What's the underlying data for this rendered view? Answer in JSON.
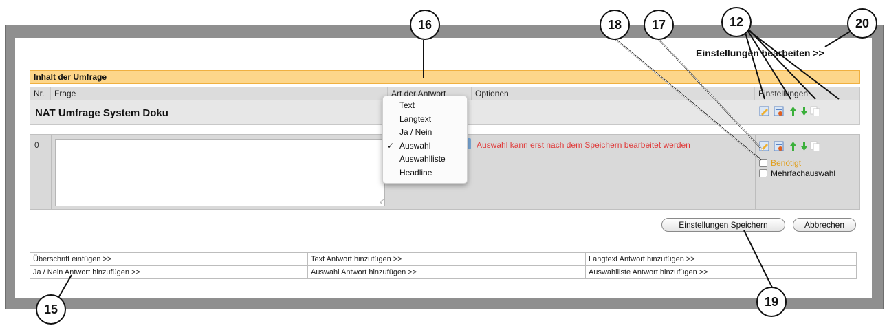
{
  "header": {
    "settings_link": "Einstellungen bearbeiten >>"
  },
  "section": {
    "title": "Inhalt der Umfrage"
  },
  "columns": {
    "nr": "Nr.",
    "frage": "Frage",
    "art": "Art der Antwort",
    "optionen": "Optionen",
    "einstellungen": "Einstellungen"
  },
  "survey": {
    "title": "NAT Umfrage System Doku"
  },
  "question": {
    "number": "0",
    "text_value": "",
    "options_note": "Auswahl kann erst nach dem Speichern bearbeitet werden",
    "required_label": "Benötigt",
    "multi_label": "Mehrfachauswahl"
  },
  "answer_type_menu": {
    "items": [
      "Text",
      "Langtext",
      "Ja / Nein",
      "Auswahl",
      "Auswahlliste",
      "Headline"
    ],
    "selected": "Auswahl",
    "check_mark": "✓"
  },
  "buttons": {
    "save": "Einstellungen Speichern",
    "cancel": "Abbrechen"
  },
  "actions": [
    [
      "Überschrift einfügen >>",
      "Text Antwort hinzufügen >>",
      "Langtext Antwort hinzufügen >>"
    ],
    [
      "Ja / Nein Antwort hinzufügen >>",
      "Auswahl Antwort hinzufügen >>",
      "Auswahlliste Antwort hinzufügen >>"
    ]
  ],
  "callouts": {
    "c12": "12",
    "c15": "15",
    "c16": "16",
    "c17": "17",
    "c18": "18",
    "c19": "19",
    "c20": "20"
  },
  "icons": {
    "edit": "edit-icon",
    "settings": "settings-icon",
    "up": "arrow-up-icon",
    "down": "arrow-down-icon",
    "copy": "copy-icon"
  },
  "colors": {
    "section_bg": "#fdd68a",
    "warning": "#e03a3a",
    "required": "#e0a020",
    "arrow": "#3bb03b"
  }
}
